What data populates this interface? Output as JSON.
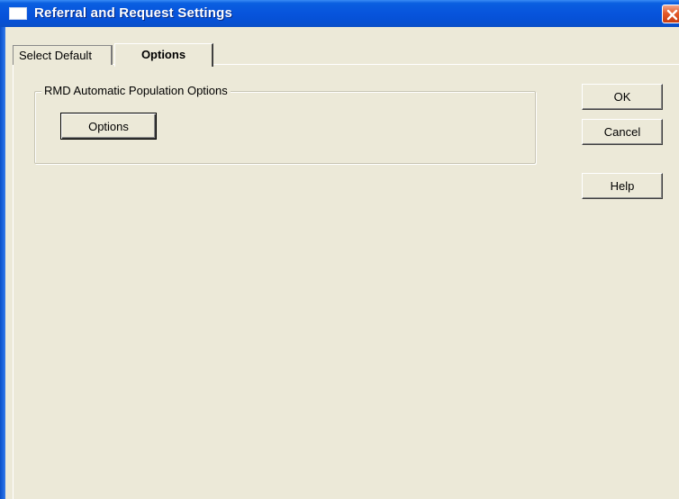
{
  "window": {
    "title": "Referral and Request Settings",
    "title_icon": "window-icon",
    "close_icon": "close-icon",
    "titlebar_color": "#0754dc",
    "close_color": "#e35b2a"
  },
  "tabs": [
    {
      "label": "Select Default",
      "selected": false
    },
    {
      "label": "Options",
      "selected": true
    }
  ],
  "group": {
    "legend": "RMD Automatic Population Options",
    "options_button_label": "Options"
  },
  "buttons": {
    "ok_label": "OK",
    "cancel_label": "Cancel",
    "help_label": "Help"
  }
}
